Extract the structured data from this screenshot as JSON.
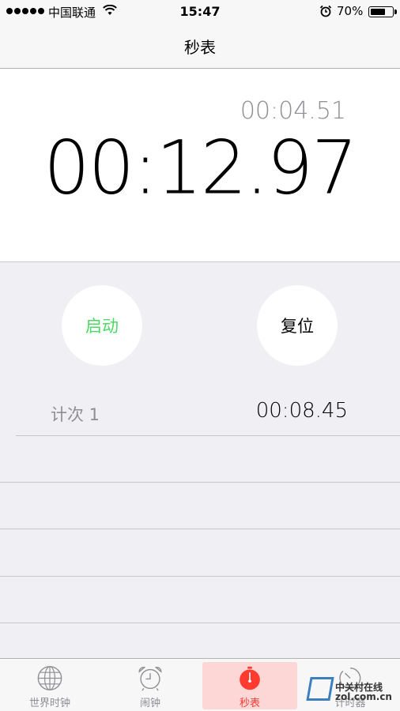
{
  "status_bar": {
    "carrier": "中国联通",
    "time": "15:47",
    "battery_percent": "70%",
    "battery_level": 0.7,
    "signal_dots": 5
  },
  "nav": {
    "title": "秒表"
  },
  "display": {
    "lap_time": "00:04.51",
    "main_time": "00:12.97"
  },
  "controls": {
    "start_label": "启动",
    "reset_label": "复位",
    "start_color": "#4cd964"
  },
  "laps": [
    {
      "label": "计次 1",
      "time": "00:08.45"
    }
  ],
  "tab_bar": {
    "tabs": [
      {
        "label": "世界时钟",
        "icon": "globe-icon",
        "active": false
      },
      {
        "label": "闹钟",
        "icon": "alarm-clock-icon",
        "active": false
      },
      {
        "label": "秒表",
        "icon": "stopwatch-icon",
        "active": true
      },
      {
        "label": "计时器",
        "icon": "timer-icon",
        "active": false
      }
    ],
    "active_color": "#ff3b30"
  },
  "watermark": {
    "line1": "中关村在线",
    "line2": "zol.com.cn"
  }
}
